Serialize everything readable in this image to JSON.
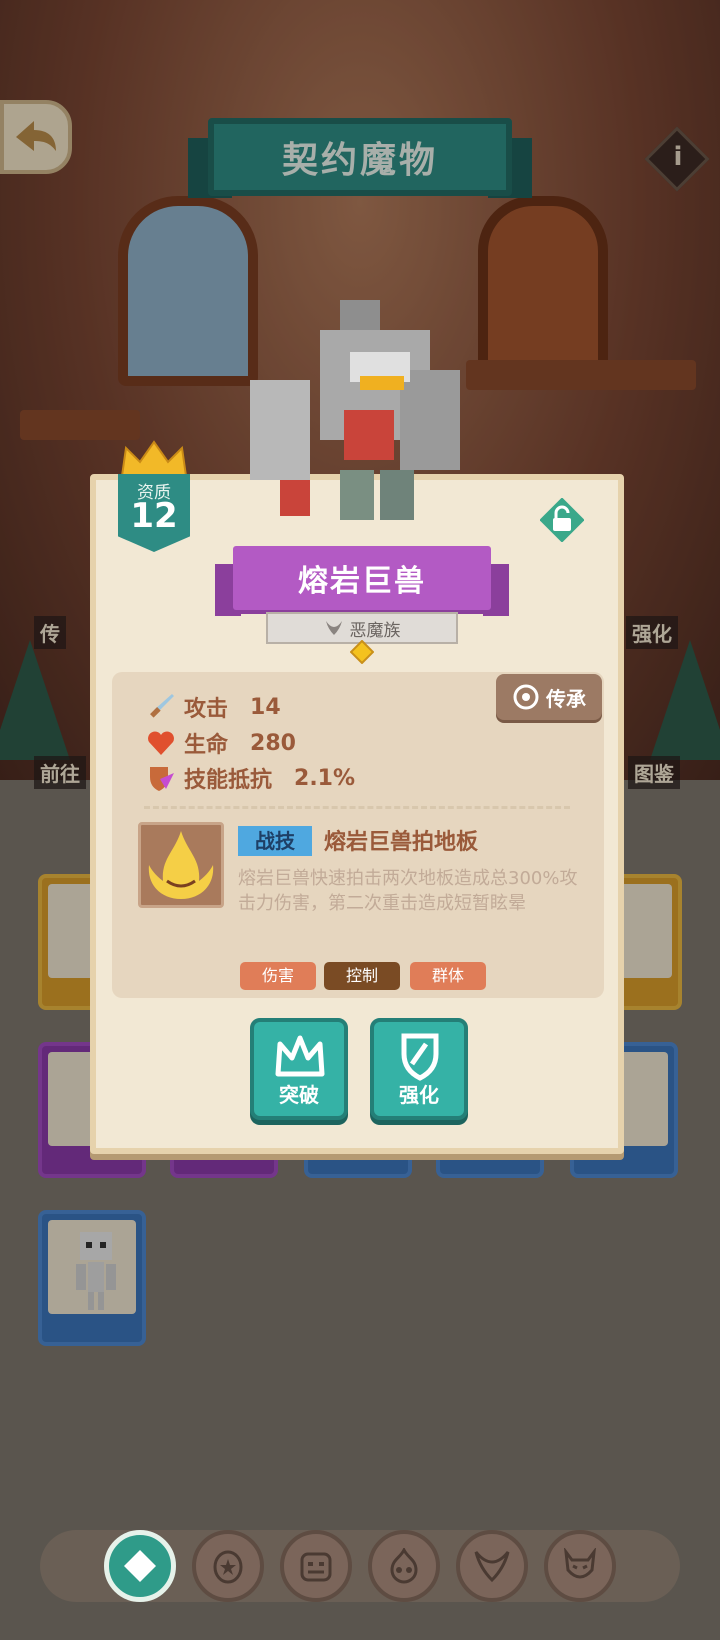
{
  "header": {
    "title": "契约魔物"
  },
  "side_labels": {
    "left_top": "传",
    "left_bottom": "前往",
    "right_top": "强化",
    "right_bottom": "图鉴"
  },
  "monster": {
    "quality_label": "资质",
    "quality_value": "12",
    "name": "熔岩巨兽",
    "race": "恶魔族"
  },
  "inherit_button": {
    "label": "传承"
  },
  "stats": [
    {
      "icon": "sword-icon",
      "label": "攻击",
      "value": "14"
    },
    {
      "icon": "heart-icon",
      "label": "生命",
      "value": "280"
    },
    {
      "icon": "shield-icon",
      "label": "技能抵抗",
      "value": "2.1%"
    }
  ],
  "skill": {
    "tag": "战技",
    "name": "熔岩巨兽拍地板",
    "description": "熔岩巨兽快速拍击两次地板造成总300%攻击力伤害，第二次重击造成短暂眩晕",
    "effects": [
      "伤害",
      "控制",
      "群体"
    ]
  },
  "actions": {
    "breakthrough": "突破",
    "enhance": "强化"
  },
  "colors": {
    "teal": "#35b2a6",
    "purple": "#b35ac4",
    "panel": "#f2e8d4",
    "stat_text": "#9a5a3a"
  },
  "nav": [
    "all-icon",
    "star-egg-icon",
    "orc-face-icon",
    "flame-skull-icon",
    "horned-demon-icon",
    "devil-icon"
  ]
}
